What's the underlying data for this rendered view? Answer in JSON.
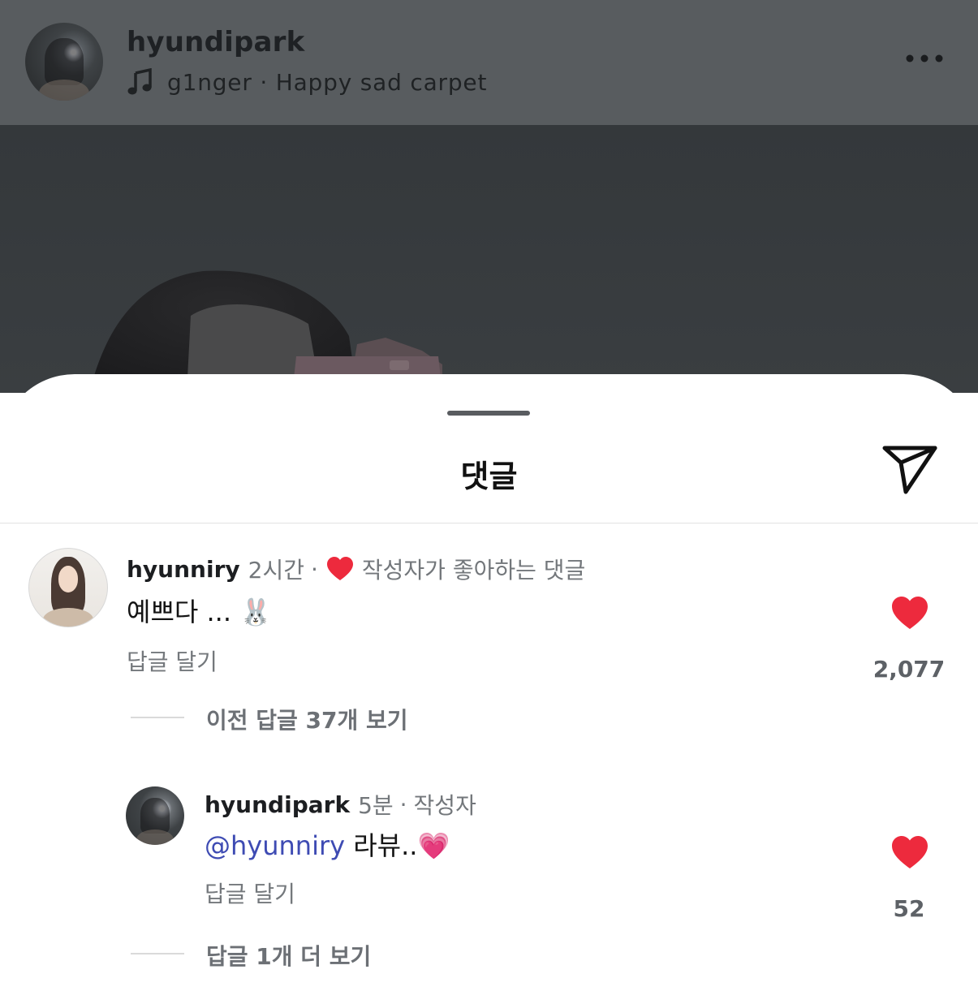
{
  "post": {
    "username": "hyundipark",
    "music_icon": "music-note-icon",
    "music": "g1nger · Happy sad carpet",
    "more_icon": "more-horizontal-icon"
  },
  "sheet": {
    "title": "댓글",
    "send_icon": "send-icon"
  },
  "comments": [
    {
      "username": "hyunniry",
      "time": "2시간",
      "separator": "·",
      "badge": "작성자가 좋아하는 댓글",
      "text": "예쁘다 ... 🐰",
      "reply_label": "답글 달기",
      "likes": "2,077",
      "liked": true,
      "view_replies": "이전 답글 37개 보기"
    },
    {
      "username": "hyundipark",
      "time": "5분",
      "separator": "·",
      "badge": "작성자",
      "mention": "@hyunniry",
      "text": "라뷰..💗",
      "reply_label": "답글 달기",
      "likes": "52",
      "liked": true,
      "view_replies": "답글 1개 더 보기"
    }
  ],
  "colors": {
    "heart": "#ed2a3d",
    "mention": "#3e4bb3",
    "header_bg": "#585c5f"
  }
}
